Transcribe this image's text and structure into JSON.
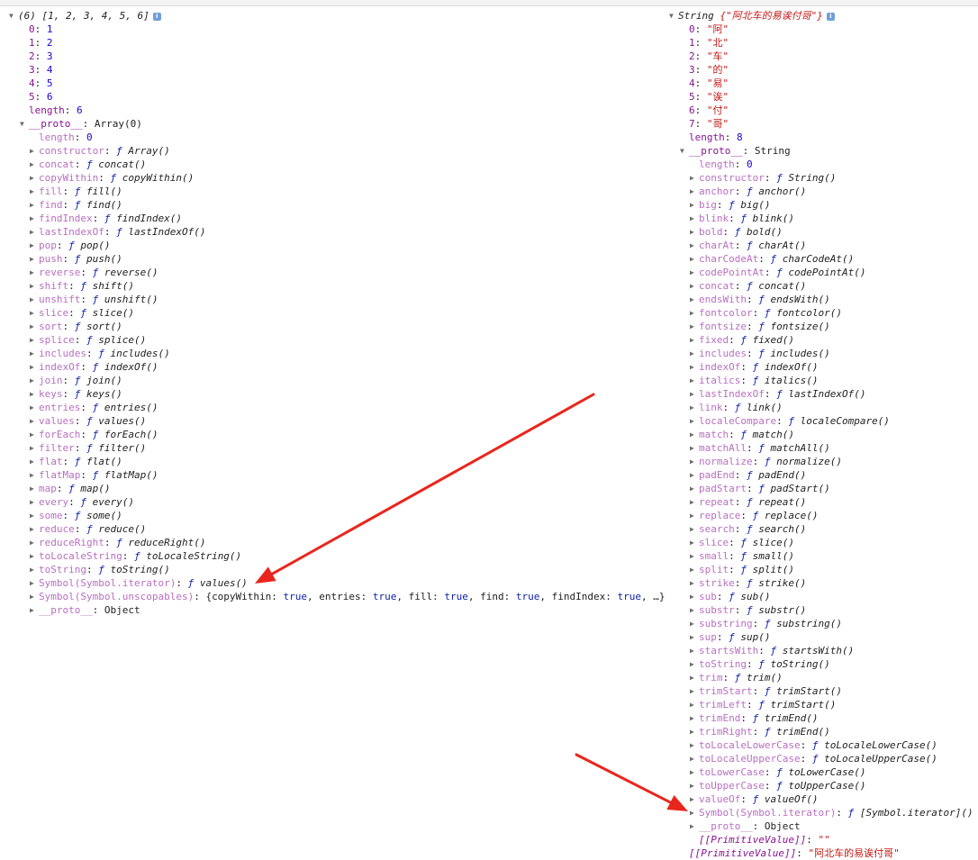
{
  "left": {
    "header": {
      "count": "(6)",
      "values": "[1, 2, 3, 4, 5, 6]"
    },
    "indices": [
      {
        "key": "0",
        "value": "1"
      },
      {
        "key": "1",
        "value": "2"
      },
      {
        "key": "2",
        "value": "3"
      },
      {
        "key": "3",
        "value": "4"
      },
      {
        "key": "4",
        "value": "5"
      },
      {
        "key": "5",
        "value": "6"
      }
    ],
    "length": {
      "key": "length",
      "value": "6"
    },
    "proto": {
      "key": "__proto__",
      "value": "Array(0)"
    },
    "proto_length": {
      "key": "length",
      "value": "0"
    },
    "methods": [
      {
        "key": "constructor",
        "fn": "Array()"
      },
      {
        "key": "concat",
        "fn": "concat()"
      },
      {
        "key": "copyWithin",
        "fn": "copyWithin()"
      },
      {
        "key": "fill",
        "fn": "fill()"
      },
      {
        "key": "find",
        "fn": "find()"
      },
      {
        "key": "findIndex",
        "fn": "findIndex()"
      },
      {
        "key": "lastIndexOf",
        "fn": "lastIndexOf()"
      },
      {
        "key": "pop",
        "fn": "pop()"
      },
      {
        "key": "push",
        "fn": "push()"
      },
      {
        "key": "reverse",
        "fn": "reverse()"
      },
      {
        "key": "shift",
        "fn": "shift()"
      },
      {
        "key": "unshift",
        "fn": "unshift()"
      },
      {
        "key": "slice",
        "fn": "slice()"
      },
      {
        "key": "sort",
        "fn": "sort()"
      },
      {
        "key": "splice",
        "fn": "splice()"
      },
      {
        "key": "includes",
        "fn": "includes()"
      },
      {
        "key": "indexOf",
        "fn": "indexOf()"
      },
      {
        "key": "join",
        "fn": "join()"
      },
      {
        "key": "keys",
        "fn": "keys()"
      },
      {
        "key": "entries",
        "fn": "entries()"
      },
      {
        "key": "values",
        "fn": "values()"
      },
      {
        "key": "forEach",
        "fn": "forEach()"
      },
      {
        "key": "filter",
        "fn": "filter()"
      },
      {
        "key": "flat",
        "fn": "flat()"
      },
      {
        "key": "flatMap",
        "fn": "flatMap()"
      },
      {
        "key": "map",
        "fn": "map()"
      },
      {
        "key": "every",
        "fn": "every()"
      },
      {
        "key": "some",
        "fn": "some()"
      },
      {
        "key": "reduce",
        "fn": "reduce()"
      },
      {
        "key": "reduceRight",
        "fn": "reduceRight()"
      },
      {
        "key": "toLocaleString",
        "fn": "toLocaleString()"
      },
      {
        "key": "toString",
        "fn": "toString()"
      }
    ],
    "symbol_iterator": {
      "key": "Symbol(Symbol.iterator)",
      "fn": "values()"
    },
    "symbol_unscopables": {
      "key": "Symbol(Symbol.unscopables)",
      "open": "{",
      "items": [
        {
          "key": "copyWithin",
          "value": "true"
        },
        {
          "key": "entries",
          "value": "true"
        },
        {
          "key": "fill",
          "value": "true"
        },
        {
          "key": "find",
          "value": "true"
        },
        {
          "key": "findIndex",
          "value": "true"
        }
      ],
      "more": "…}"
    },
    "proto_object": {
      "key": "__proto__",
      "value": "Object"
    }
  },
  "right": {
    "header": {
      "type": "String",
      "value": "{\"阿北车的易诶付哥\"}"
    },
    "indices": [
      {
        "key": "0",
        "value": "\"阿\""
      },
      {
        "key": "1",
        "value": "\"北\""
      },
      {
        "key": "2",
        "value": "\"车\""
      },
      {
        "key": "3",
        "value": "\"的\""
      },
      {
        "key": "4",
        "value": "\"易\""
      },
      {
        "key": "5",
        "value": "\"诶\""
      },
      {
        "key": "6",
        "value": "\"付\""
      },
      {
        "key": "7",
        "value": "\"哥\""
      }
    ],
    "length": {
      "key": "length",
      "value": "8"
    },
    "proto": {
      "key": "__proto__",
      "value": "String"
    },
    "proto_length": {
      "key": "length",
      "value": "0"
    },
    "methods": [
      {
        "key": "constructor",
        "fn": "String()"
      },
      {
        "key": "anchor",
        "fn": "anchor()"
      },
      {
        "key": "big",
        "fn": "big()"
      },
      {
        "key": "blink",
        "fn": "blink()"
      },
      {
        "key": "bold",
        "fn": "bold()"
      },
      {
        "key": "charAt",
        "fn": "charAt()"
      },
      {
        "key": "charCodeAt",
        "fn": "charCodeAt()"
      },
      {
        "key": "codePointAt",
        "fn": "codePointAt()"
      },
      {
        "key": "concat",
        "fn": "concat()"
      },
      {
        "key": "endsWith",
        "fn": "endsWith()"
      },
      {
        "key": "fontcolor",
        "fn": "fontcolor()"
      },
      {
        "key": "fontsize",
        "fn": "fontsize()"
      },
      {
        "key": "fixed",
        "fn": "fixed()"
      },
      {
        "key": "includes",
        "fn": "includes()"
      },
      {
        "key": "indexOf",
        "fn": "indexOf()"
      },
      {
        "key": "italics",
        "fn": "italics()"
      },
      {
        "key": "lastIndexOf",
        "fn": "lastIndexOf()"
      },
      {
        "key": "link",
        "fn": "link()"
      },
      {
        "key": "localeCompare",
        "fn": "localeCompare()"
      },
      {
        "key": "match",
        "fn": "match()"
      },
      {
        "key": "matchAll",
        "fn": "matchAll()"
      },
      {
        "key": "normalize",
        "fn": "normalize()"
      },
      {
        "key": "padEnd",
        "fn": "padEnd()"
      },
      {
        "key": "padStart",
        "fn": "padStart()"
      },
      {
        "key": "repeat",
        "fn": "repeat()"
      },
      {
        "key": "replace",
        "fn": "replace()"
      },
      {
        "key": "search",
        "fn": "search()"
      },
      {
        "key": "slice",
        "fn": "slice()"
      },
      {
        "key": "small",
        "fn": "small()"
      },
      {
        "key": "split",
        "fn": "split()"
      },
      {
        "key": "strike",
        "fn": "strike()"
      },
      {
        "key": "sub",
        "fn": "sub()"
      },
      {
        "key": "substr",
        "fn": "substr()"
      },
      {
        "key": "substring",
        "fn": "substring()"
      },
      {
        "key": "sup",
        "fn": "sup()"
      },
      {
        "key": "startsWith",
        "fn": "startsWith()"
      },
      {
        "key": "toString",
        "fn": "toString()"
      },
      {
        "key": "trim",
        "fn": "trim()"
      },
      {
        "key": "trimStart",
        "fn": "trimStart()"
      },
      {
        "key": "trimLeft",
        "fn": "trimStart()"
      },
      {
        "key": "trimEnd",
        "fn": "trimEnd()"
      },
      {
        "key": "trimRight",
        "fn": "trimEnd()"
      },
      {
        "key": "toLocaleLowerCase",
        "fn": "toLocaleLowerCase()"
      },
      {
        "key": "toLocaleUpperCase",
        "fn": "toLocaleUpperCase()"
      },
      {
        "key": "toLowerCase",
        "fn": "toLowerCase()"
      },
      {
        "key": "toUpperCase",
        "fn": "toUpperCase()"
      },
      {
        "key": "valueOf",
        "fn": "valueOf()"
      }
    ],
    "symbol_iterator": {
      "key": "Symbol(Symbol.iterator)",
      "fn": "[Symbol.iterator]()"
    },
    "proto_object": {
      "key": "__proto__",
      "value": "Object"
    },
    "inner_primitive": {
      "key": "[[PrimitiveValue]]",
      "value": "\"\""
    },
    "outer_primitive": {
      "key": "[[PrimitiveValue]]",
      "value": "\"阿北车的易诶付哥\""
    }
  },
  "glyphs": {
    "expanded": "▼",
    "collapsed": "▶",
    "fn": "ƒ",
    "info": "i"
  },
  "colors": {
    "own_key": "#881391",
    "inherited_key": "#b96fc1",
    "number": "#1c00cf",
    "string": "#c41a16",
    "fn_keyword": "#0d22aa",
    "annotation_arrow": "#e8261c"
  }
}
